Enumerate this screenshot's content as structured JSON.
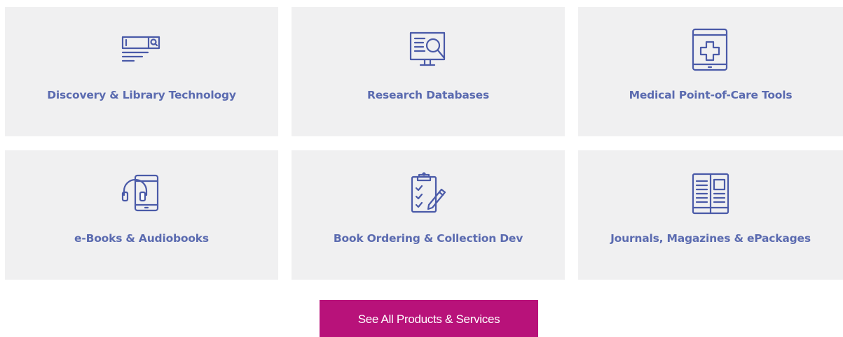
{
  "tiles": [
    {
      "label": "Discovery & Library Technology",
      "icon": "search-bar-icon"
    },
    {
      "label": "Research Databases",
      "icon": "monitor-search-icon"
    },
    {
      "label": "Medical Point-of-Care Tools",
      "icon": "tablet-medical-cross-icon"
    },
    {
      "label": "e-Books & Audiobooks",
      "icon": "headphones-tablet-icon"
    },
    {
      "label": "Book Ordering & Collection Dev",
      "icon": "clipboard-checklist-pencil-icon"
    },
    {
      "label": "Journals, Magazines & ePackages",
      "icon": "open-magazine-icon"
    }
  ],
  "cta": {
    "label": "See All Products & Services"
  },
  "colors": {
    "tile_bg": "#f0f0f1",
    "accent_text": "#5b6bb0",
    "icon_stroke": "#4a5aa8",
    "cta_bg": "#b8127a",
    "cta_text": "#ffffff"
  }
}
